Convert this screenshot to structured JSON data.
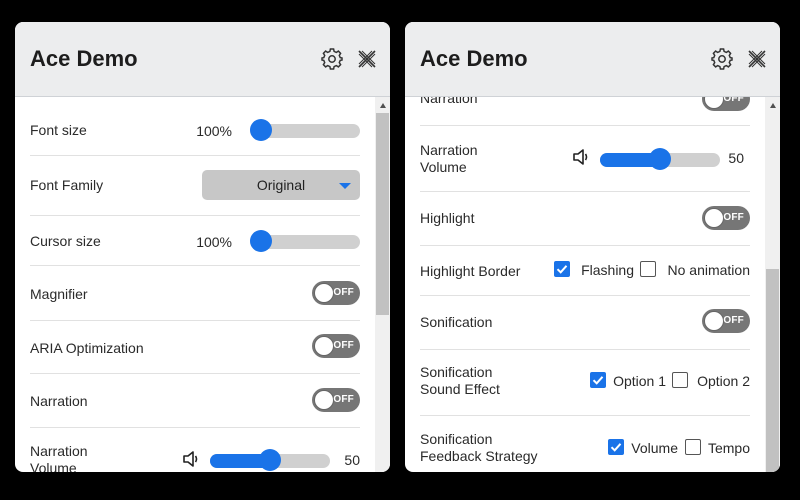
{
  "left_panel": {
    "title": "Ace Demo",
    "font_size": {
      "label": "Font size",
      "value": "100%",
      "level": 0.0
    },
    "font_family": {
      "label": "Font Family",
      "value": "Original"
    },
    "cursor_size": {
      "label": "Cursor size",
      "value": "100%",
      "level": 0.0
    },
    "magnifier": {
      "label": "Magnifier",
      "state": "OFF"
    },
    "aria": {
      "label": "ARIA Optimization",
      "state": "OFF"
    },
    "narration": {
      "label": "Narration",
      "state": "OFF"
    },
    "narration_volume": {
      "label": "Narration\nVolume",
      "value": "50",
      "level": 0.5
    }
  },
  "right_panel": {
    "title": "Ace Demo",
    "narration": {
      "label": "Narration",
      "state": "OFF"
    },
    "narration_volume": {
      "label": "Narration\nVolume",
      "value": "50",
      "level": 0.5
    },
    "highlight": {
      "label": "Highlight",
      "state": "OFF"
    },
    "highlight_border": {
      "label": "Highlight Border",
      "option1": "Flashing",
      "option1_checked": true,
      "option2": "No animation",
      "option2_checked": false
    },
    "sonification": {
      "label": "Sonification",
      "state": "OFF"
    },
    "sound_effect": {
      "label": "Sonification\nSound Effect",
      "option1": "Option 1",
      "option1_checked": true,
      "option2": "Option 2",
      "option2_checked": false
    },
    "feedback_strategy": {
      "label": "Sonification\nFeedback Strategy",
      "option1": "Volume",
      "option1_checked": true,
      "option2": "Tempo",
      "option2_checked": false
    }
  },
  "icons": {
    "settings": "gear-icon",
    "close": "close-icon",
    "volume": "speaker-icon",
    "check": "checkmark-icon"
  },
  "colors": {
    "accent": "#1a73e8",
    "toggle_off": "#767676",
    "header_bg": "#ecedee",
    "select_bg": "#c7c7c7"
  }
}
